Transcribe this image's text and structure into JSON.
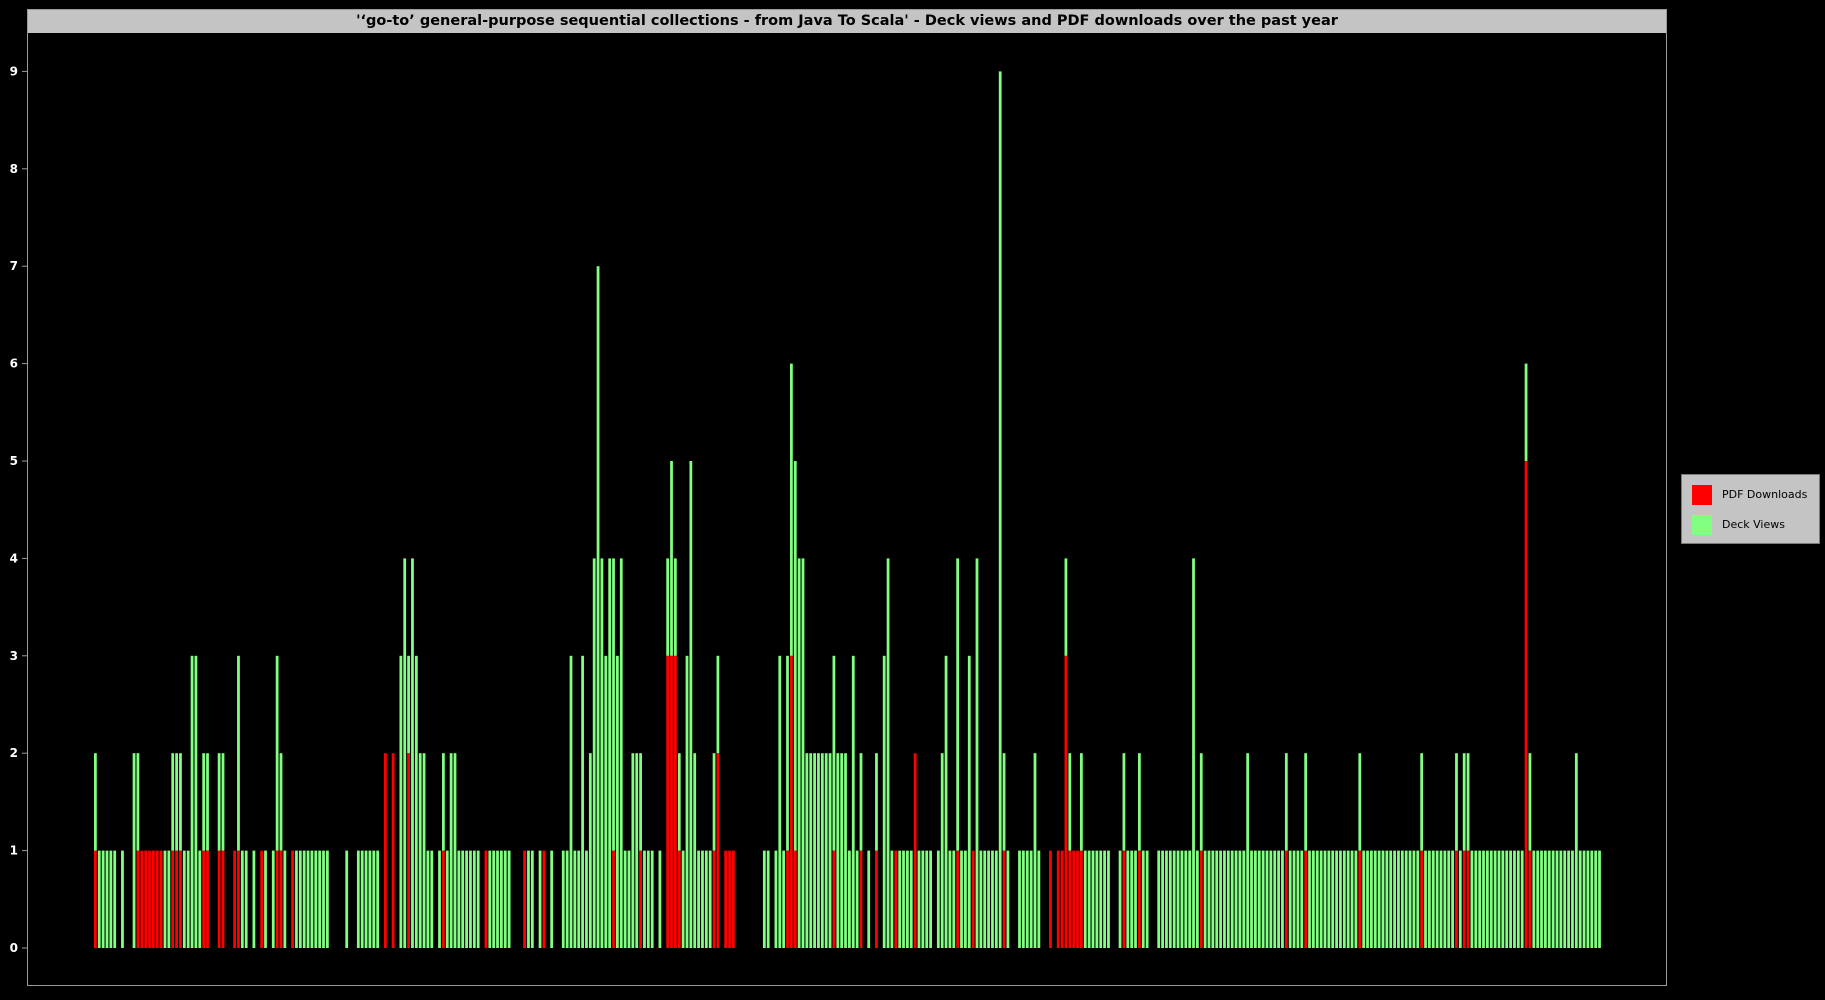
{
  "chart_data": {
    "type": "bar",
    "stacked": true,
    "title": "'‘go-to’ general-purpose sequential collections - from Java To Scala' - Deck views and PDF downloads over the past year",
    "xlabel": "",
    "ylabel": "",
    "ylim": [
      0,
      9
    ],
    "yticks": [
      0,
      1,
      2,
      3,
      4,
      5,
      6,
      7,
      8,
      9
    ],
    "grid": false,
    "legend_position": "right",
    "x_unit": "day (past year, daily bars)",
    "series": [
      {
        "name": "PDF Downloads",
        "color": "#ff0000",
        "values": [
          1,
          0,
          0,
          0,
          0,
          0,
          0,
          0,
          0,
          0,
          0,
          1,
          1,
          1,
          1,
          1,
          1,
          1,
          0,
          0,
          1,
          1,
          1,
          0,
          0,
          0,
          0,
          0,
          1,
          1,
          0,
          0,
          1,
          1,
          0,
          0,
          1,
          1,
          0,
          0,
          0,
          0,
          0,
          1,
          0,
          0,
          0,
          1,
          1,
          0,
          0,
          1,
          0,
          0,
          0,
          0,
          0,
          0,
          0,
          0,
          0,
          0,
          0,
          0,
          0,
          0,
          0,
          0,
          0,
          0,
          0,
          0,
          0,
          0,
          0,
          2,
          0,
          2,
          0,
          0,
          0,
          2,
          0,
          0,
          0,
          0,
          0,
          0,
          0,
          0,
          1,
          0,
          0,
          0,
          0,
          0,
          0,
          0,
          0,
          0,
          0,
          1,
          0,
          0,
          0,
          0,
          0,
          0,
          0,
          0,
          0,
          1,
          0,
          0,
          0,
          0,
          1,
          0,
          0,
          0,
          0,
          0,
          0,
          0,
          0,
          0,
          0,
          0,
          0,
          0,
          0,
          0,
          0,
          0,
          1,
          0,
          0,
          0,
          0,
          0,
          0,
          1,
          0,
          0,
          0,
          0,
          0,
          0,
          3,
          3,
          3,
          1,
          0,
          0,
          0,
          0,
          0,
          0,
          0,
          0,
          1,
          2,
          0,
          1,
          1,
          1,
          0,
          0,
          0,
          0,
          0,
          0,
          0,
          0,
          0,
          0,
          0,
          0,
          0,
          1,
          3,
          1,
          0,
          0,
          0,
          0,
          0,
          0,
          0,
          0,
          0,
          1,
          0,
          0,
          0,
          0,
          0,
          0,
          1,
          0,
          0,
          0,
          1,
          0,
          0,
          0,
          0,
          1,
          0,
          0,
          0,
          0,
          2,
          0,
          0,
          0,
          0,
          0,
          0,
          0,
          0,
          0,
          0,
          1,
          0,
          0,
          0,
          1,
          0,
          0,
          0,
          0,
          0,
          0,
          0,
          1,
          0,
          0,
          0,
          0,
          0,
          0,
          0,
          0,
          0,
          0,
          0,
          1,
          0,
          1,
          1,
          3,
          1,
          1,
          1,
          1,
          0,
          0,
          0,
          0,
          0,
          0,
          0,
          0,
          0,
          0,
          1,
          0,
          0,
          0,
          1,
          0,
          0,
          0,
          0,
          0,
          0,
          0,
          0,
          0,
          0,
          0,
          0,
          0,
          0,
          0,
          1,
          0,
          0,
          0,
          0,
          0,
          0,
          0,
          0,
          0,
          0,
          0,
          0,
          0,
          0,
          0,
          0,
          0,
          0,
          0,
          0,
          0,
          1,
          0,
          0,
          0,
          0,
          1,
          0,
          0,
          0,
          0,
          0,
          0,
          0,
          0,
          0,
          0,
          0,
          0,
          0,
          1,
          0,
          0,
          0,
          0,
          0,
          0,
          0,
          0,
          0,
          0,
          0,
          0,
          0,
          0,
          0,
          1,
          0,
          0,
          0,
          0,
          0,
          0,
          0,
          0,
          1,
          0,
          1,
          1,
          0,
          0,
          0,
          0,
          0,
          0,
          0,
          0,
          0,
          0,
          0,
          0,
          0,
          0,
          5,
          1,
          0,
          0,
          0,
          0
        ]
      },
      {
        "name": "Deck Views",
        "color": "#80ff80",
        "values": [
          1,
          1,
          1,
          1,
          1,
          1,
          0,
          1,
          0,
          0,
          2,
          1,
          0,
          0,
          0,
          0,
          0,
          0,
          1,
          1,
          1,
          1,
          1,
          1,
          1,
          3,
          3,
          1,
          1,
          1,
          0,
          0,
          1,
          1,
          0,
          0,
          0,
          2,
          1,
          1,
          0,
          1,
          0,
          0,
          1,
          0,
          1,
          2,
          1,
          1,
          0,
          0,
          1,
          1,
          1,
          1,
          1,
          1,
          1,
          1,
          1,
          0,
          0,
          0,
          0,
          1,
          0,
          0,
          1,
          1,
          1,
          1,
          1,
          1,
          0,
          0,
          0,
          0,
          0,
          3,
          4,
          1,
          4,
          3,
          2,
          2,
          1,
          1,
          0,
          1,
          1,
          1,
          2,
          2,
          1,
          1,
          1,
          1,
          1,
          1,
          0,
          0,
          1,
          1,
          1,
          1,
          1,
          1,
          0,
          0,
          0,
          0,
          1,
          1,
          0,
          1,
          0,
          0,
          1,
          0,
          0,
          1,
          1,
          3,
          1,
          1,
          3,
          1,
          2,
          4,
          7,
          4,
          3,
          4,
          3,
          3,
          4,
          1,
          1,
          2,
          2,
          1,
          1,
          1,
          1,
          0,
          1,
          0,
          1,
          2,
          1,
          1,
          1,
          3,
          5,
          2,
          1,
          1,
          1,
          1,
          1,
          1,
          0,
          0,
          0,
          0,
          0,
          0,
          0,
          0,
          0,
          0,
          0,
          1,
          1,
          0,
          1,
          3,
          1,
          2,
          3,
          4,
          4,
          4,
          2,
          2,
          2,
          2,
          2,
          2,
          2,
          2,
          2,
          2,
          2,
          1,
          3,
          1,
          1,
          0,
          1,
          0,
          1,
          0,
          3,
          4,
          1,
          0,
          1,
          1,
          1,
          1,
          0,
          1,
          1,
          1,
          1,
          0,
          1,
          2,
          3,
          1,
          1,
          3,
          1,
          1,
          3,
          0,
          4,
          1,
          1,
          1,
          1,
          1,
          9,
          1,
          1,
          0,
          0,
          1,
          1,
          1,
          1,
          2,
          1,
          0,
          0,
          0,
          0,
          0,
          0,
          1,
          1,
          0,
          0,
          1,
          1,
          1,
          1,
          1,
          1,
          1,
          1,
          0,
          0,
          1,
          1,
          1,
          1,
          1,
          1,
          1,
          1,
          0,
          0,
          1,
          1,
          1,
          1,
          1,
          1,
          1,
          1,
          1,
          4,
          1,
          1,
          1,
          1,
          1,
          1,
          1,
          1,
          1,
          1,
          1,
          1,
          1,
          2,
          1,
          1,
          1,
          1,
          1,
          1,
          1,
          1,
          1,
          1,
          1,
          1,
          1,
          1,
          1,
          1,
          1,
          1,
          1,
          1,
          1,
          1,
          1,
          1,
          1,
          1,
          1,
          1,
          1,
          1,
          1,
          1,
          1,
          1,
          1,
          1,
          1,
          1,
          1,
          1,
          1,
          1,
          1,
          1,
          1,
          1,
          1,
          1,
          1,
          1,
          1,
          1,
          1,
          1,
          1,
          1,
          1,
          1,
          1,
          1,
          1,
          1,
          1,
          1,
          1,
          1,
          1,
          1,
          1,
          1,
          1,
          1,
          1,
          1,
          1,
          1,
          1,
          1,
          1,
          1,
          1,
          1,
          1,
          1,
          2,
          1,
          1,
          1,
          1,
          1,
          1
        ]
      }
    ]
  }
}
